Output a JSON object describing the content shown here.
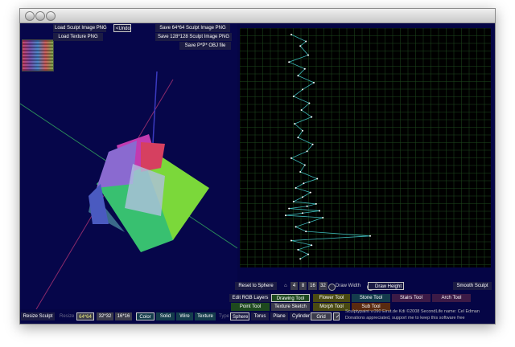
{
  "window": {
    "traffic_lights": [
      "close",
      "minimize",
      "zoom"
    ]
  },
  "top_buttons": {
    "load_sculpt": "Load Sculpt Image PNG",
    "load_texture": "Load Texture PNG",
    "undo": "<Undo",
    "save_64": "Save 64*64 Sculpt Image PNG",
    "save_128": "Save 128*128 Sculpt Image PNG",
    "save_obj": "Save  P*P*  OBJ file"
  },
  "grid_controls": {
    "reset": "Reset to Sphere",
    "counts": [
      "4",
      "8",
      "16",
      "32"
    ],
    "draw_width": "Draw Width",
    "draw_height": "Draw Height",
    "smooth": "Smooth Sculpt"
  },
  "tools": {
    "edit_rgb": "Edit RGB Layers",
    "drawing": "Drawing Tool",
    "flower": "Flower Tool",
    "stone": "Stone Tool",
    "stairs": "Stairs Tool",
    "arch": "Arch Tool",
    "point": "Point Tool",
    "texture_sketch": "Texture Sketch",
    "morph": "Morph Tool",
    "sub": "Sub Tool"
  },
  "bottom_bar": {
    "resize": "Resize Sculpt",
    "resize_label": "Resize",
    "sizes": [
      "64*64",
      "32*32",
      "16*16"
    ],
    "render_modes": [
      "Color",
      "Solid",
      "Wire",
      "Texture"
    ],
    "type_label": "Type",
    "types": [
      "Sphere",
      "Torus",
      "Plane",
      "Cylinder"
    ],
    "grid": "Grid",
    "grid_check": "✓"
  },
  "credits": [
    "Sculptypaint v.090 Eirut.de Kdi ©2008  SecondLife name: Cel Edman",
    "Donations appreciated, support me to keep this software free"
  ],
  "colors": {
    "background": "#050545",
    "grid_line": "#1e4a1e",
    "profile_line": "#3cb8b8",
    "profile_points": "#ffffff"
  },
  "profile_chart": {
    "x": [
      0.6,
      0.73,
      0.68,
      0.75,
      0.58,
      0.72,
      0.66,
      0.8,
      0.7,
      0.62,
      0.76,
      0.69,
      0.78,
      0.63,
      0.7,
      0.66,
      0.79,
      0.74,
      0.6,
      0.72,
      0.68,
      0.83,
      0.71,
      0.64,
      0.77,
      0.7,
      0.62,
      0.82,
      0.74,
      0.58,
      0.85,
      0.7,
      0.55,
      0.88,
      0.76,
      0.64,
      0.73,
      1.3,
      0.6,
      0.78,
      0.66,
      0.75,
      0.68
    ],
    "y": [
      0.0,
      0.03,
      0.05,
      0.09,
      0.12,
      0.15,
      0.18,
      0.21,
      0.24,
      0.27,
      0.3,
      0.33,
      0.36,
      0.39,
      0.42,
      0.45,
      0.48,
      0.51,
      0.54,
      0.57,
      0.6,
      0.63,
      0.65,
      0.67,
      0.69,
      0.71,
      0.73,
      0.74,
      0.75,
      0.76,
      0.77,
      0.78,
      0.79,
      0.8,
      0.82,
      0.84,
      0.86,
      0.88,
      0.9,
      0.92,
      0.94,
      0.96,
      0.98
    ]
  }
}
